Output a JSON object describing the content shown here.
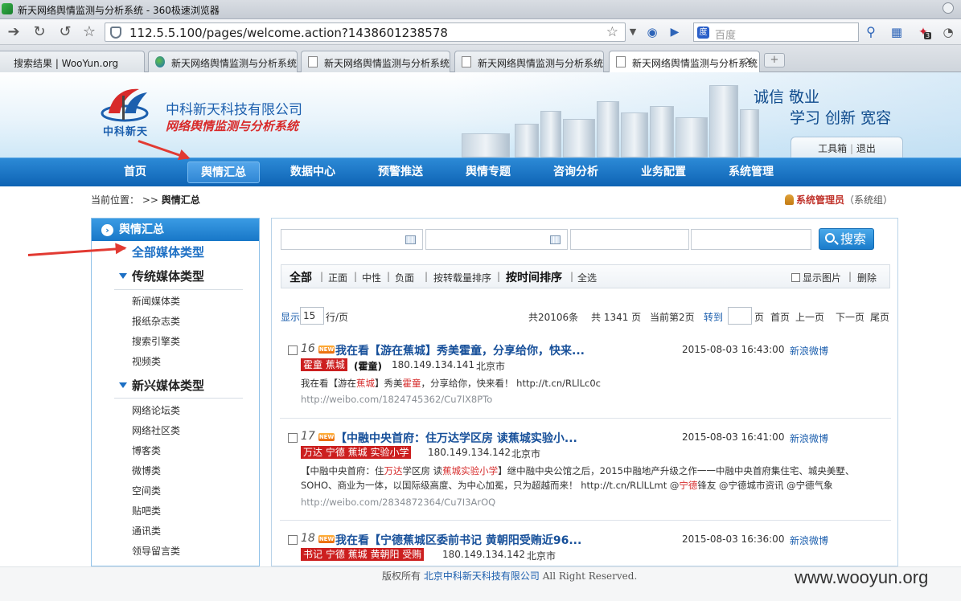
{
  "browser": {
    "window_title": "新天网络舆情监测与分析系统 - 360极速浏览器",
    "url": "112.5.5.100/pages/welcome.action?1438601238578",
    "search_placeholder": "百度",
    "badge_count": "3",
    "tabs": [
      {
        "label": "搜索结果 | WooYun.org"
      },
      {
        "label": "新天网络舆情监测与分析系统"
      },
      {
        "label": "新天网络舆情监测与分析系统"
      },
      {
        "label": "新天网络舆情监测与分析系统"
      },
      {
        "label": "新天网络舆情监测与分析系统",
        "active": true
      }
    ]
  },
  "header": {
    "logo_caption": "中科新天",
    "company": "中科新天科技有限公司",
    "system": "网络舆情监测与分析系统",
    "slogan_line1": "诚信 敬业",
    "slogan_line2": "学习 创新 宽容",
    "toolbox": "工具箱",
    "logout": "退出"
  },
  "nav": {
    "items": [
      "首页",
      "舆情汇总",
      "数据中心",
      "预警推送",
      "舆情专题",
      "咨询分析",
      "业务配置",
      "系统管理"
    ],
    "active_index": 1
  },
  "breadcrumb": {
    "prefix": "当前位置： >>",
    "current": "舆情汇总"
  },
  "user": {
    "name": "系统管理员",
    "group": "（系统组）"
  },
  "sidebar": {
    "title": "舆情汇总",
    "all": "全部媒体类型",
    "groups": [
      {
        "name": "传统媒体类型",
        "items": [
          "新闻媒体类",
          "报纸杂志类",
          "搜索引擎类",
          "视频类"
        ]
      },
      {
        "name": "新兴媒体类型",
        "items": [
          "网络论坛类",
          "网络社区类",
          "博客类",
          "微博类",
          "空间类",
          "贴吧类",
          "通讯类",
          "领导留言类"
        ]
      }
    ]
  },
  "filters": {
    "search_label": "搜索"
  },
  "toolbar": {
    "all": "全部",
    "positive": "正面",
    "neutral": "中性",
    "negative": "负面",
    "sort_repost": "按转载量排序",
    "sort_time": "按时间排序",
    "select_all": "全选",
    "show_images": "显示图片",
    "delete": "删除"
  },
  "pager": {
    "show": "显示",
    "per_page": "15",
    "rows_unit": "行/页",
    "total": "共20106条",
    "pages": "共 1341 页",
    "current": "当前第2页",
    "goto": "转到",
    "page_unit": "页",
    "first": "首页",
    "prev": "上一页",
    "next": "下一页",
    "last": "尾页"
  },
  "items": [
    {
      "num": "16",
      "title": "我在看【游在蕉城】秀美霍童，分享给你，快来...",
      "date": "2015-08-03 16:43:00",
      "source": "新浪微博",
      "tags": "霍童 蕉城",
      "author": "(霍童)",
      "ip": "180.149.134.141",
      "city": "北京市",
      "summary_parts": [
        "我在看【游在",
        "蕉城",
        "】秀美",
        "霍童",
        "，分享给你，快来看！  http://t.cn/RLlLc0c"
      ],
      "link": "http://weibo.com/1824745362/Cu7lX8PTo"
    },
    {
      "num": "17",
      "title": "【中融中央首府：住万达学区房  读蕉城实验小...",
      "date": "2015-08-03 16:41:00",
      "source": "新浪微博",
      "tags": "万达 宁德 蕉城 实验小学",
      "author": "",
      "ip": "180.149.134.142",
      "city": "北京市",
      "summary_parts": [
        "【中融中央首府：住",
        "万达",
        "学区房  读",
        "蕉城实验小学",
        "】继中融中央公馆之后，2015中融地产升级之作一一中融中央首府集住宅、城央美墅、SOHO、商业为一体，以国际级高度、为中心加冕，只为超越而来！  http://t.cn/RLlLLmt @",
        "宁德",
        "锋友  @宁德城市资讯  @宁德气象"
      ],
      "link": "http://weibo.com/2834872364/Cu7I3ArOQ"
    },
    {
      "num": "18",
      "title": "我在看【宁德蕉城区委前书记  黄朝阳受贿近96...",
      "date": "2015-08-03 16:36:00",
      "source": "新浪微博",
      "tags": "书记 宁德 蕉城 黄朝阳 受贿",
      "author": "",
      "ip": "180.149.134.142",
      "city": "北京市",
      "summary_parts": [],
      "link": ""
    }
  ],
  "footer": {
    "prefix": "版权所有",
    "company": "北京中科新天科技有限公司",
    "rights": "All Right Reserved."
  },
  "watermark": "www.wooyun.org"
}
